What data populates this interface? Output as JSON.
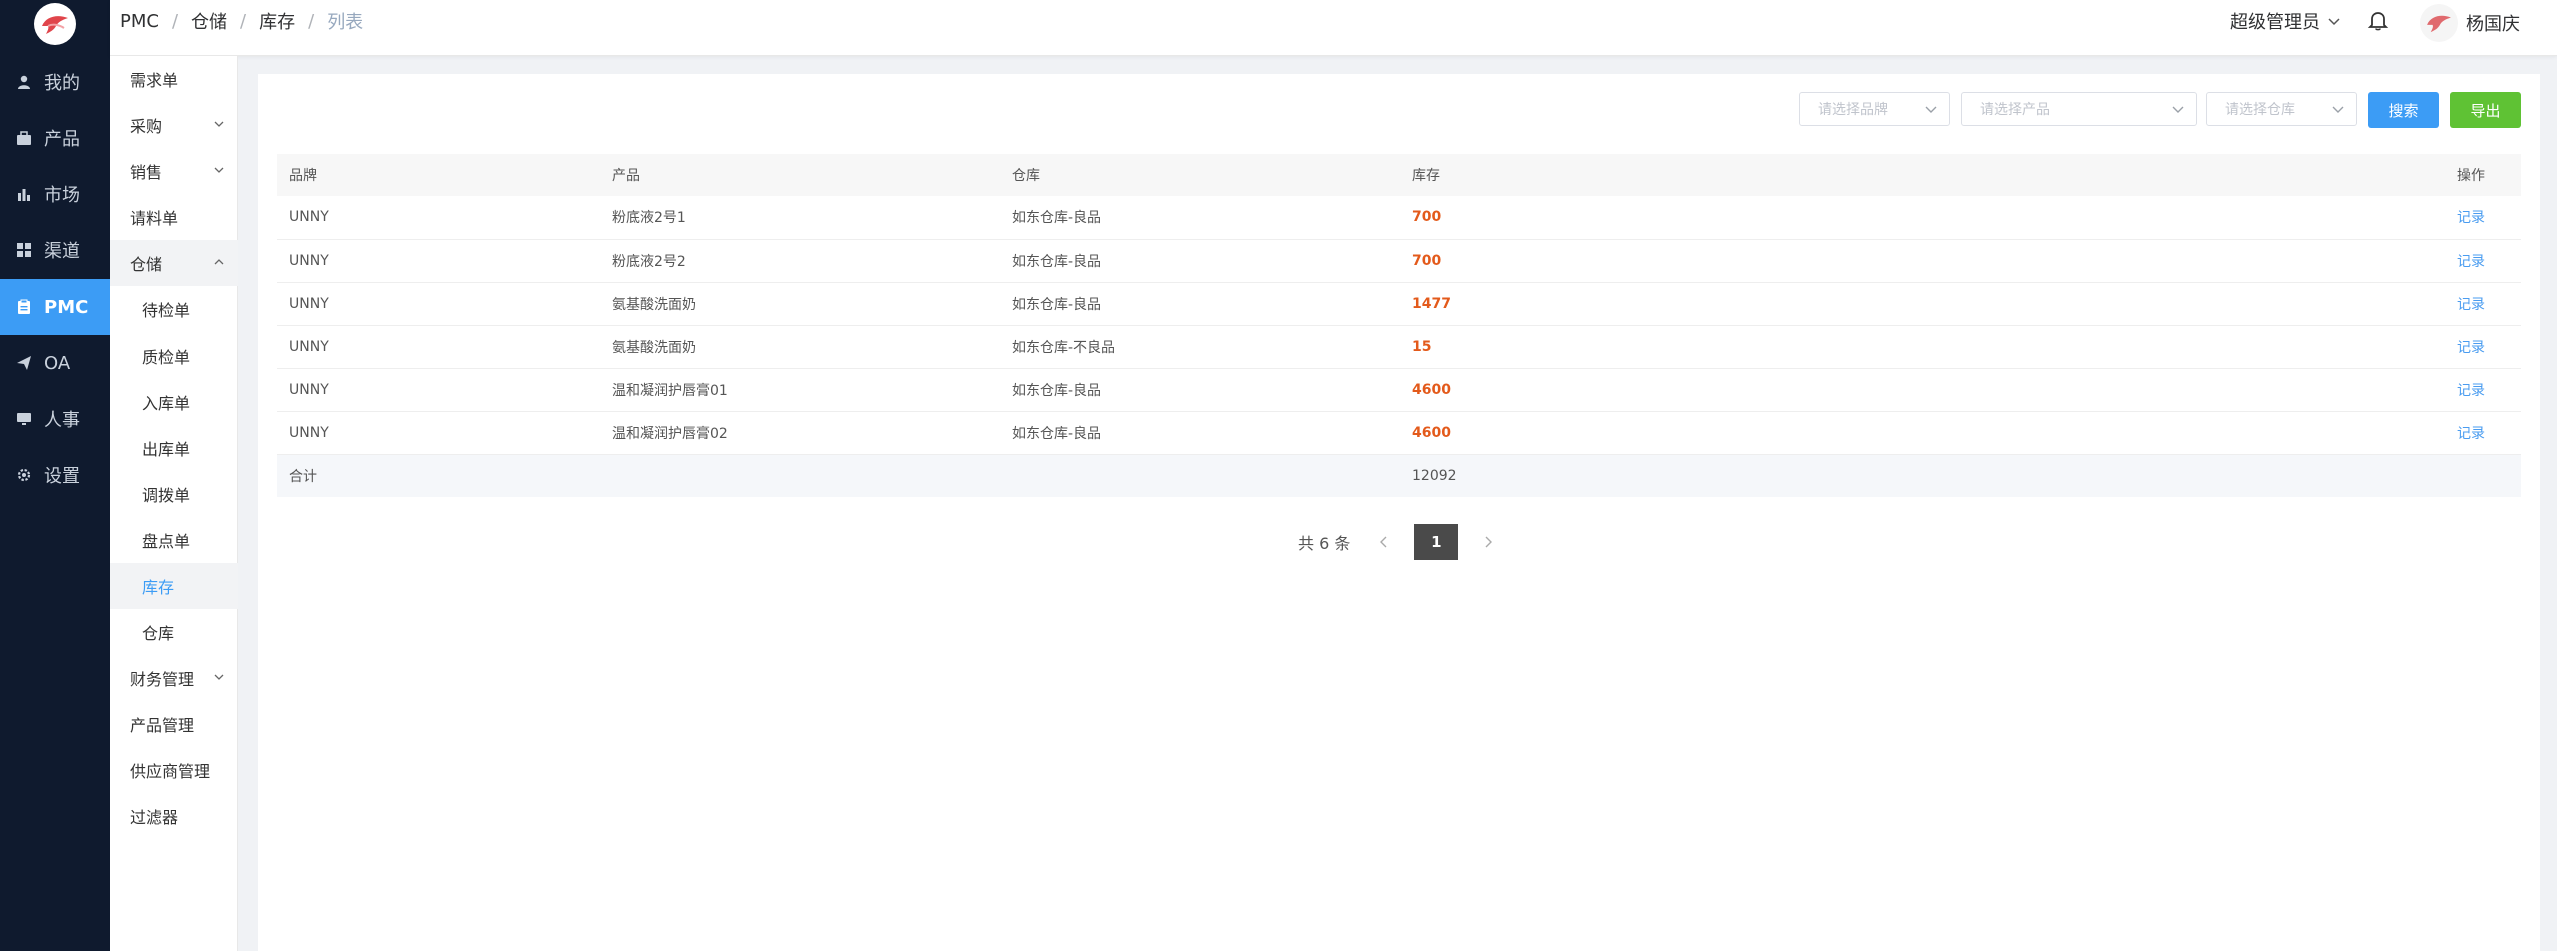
{
  "rail": {
    "items": [
      {
        "label": "我的",
        "icon": "user-icon"
      },
      {
        "label": "产品",
        "icon": "briefcase-icon"
      },
      {
        "label": "市场",
        "icon": "bar-chart-icon"
      },
      {
        "label": "渠道",
        "icon": "grid-icon"
      },
      {
        "label": "PMC",
        "icon": "clipboard-icon",
        "active": true
      },
      {
        "label": "OA",
        "icon": "paper-plane-icon"
      },
      {
        "label": "人事",
        "icon": "monitor-icon"
      },
      {
        "label": "设置",
        "icon": "gear-icon"
      }
    ]
  },
  "subnav": {
    "items": [
      {
        "label": "需求单"
      },
      {
        "label": "采购"
      },
      {
        "label": "销售"
      },
      {
        "label": "请料单"
      },
      {
        "label": "仓储"
      },
      {
        "label": "待检单"
      },
      {
        "label": "质检单"
      },
      {
        "label": "入库单"
      },
      {
        "label": "出库单"
      },
      {
        "label": "调拨单"
      },
      {
        "label": "盘点单"
      },
      {
        "label": "库存"
      },
      {
        "label": "仓库"
      },
      {
        "label": "财务管理"
      },
      {
        "label": "产品管理"
      },
      {
        "label": "供应商管理"
      },
      {
        "label": "过滤器"
      }
    ]
  },
  "header": {
    "breadcrumb": [
      "PMC",
      "仓储",
      "库存",
      "列表"
    ],
    "role": "超级管理员",
    "username": "杨国庆"
  },
  "filters": {
    "brand_placeholder": "请选择品牌",
    "product_placeholder": "请选择产品",
    "warehouse_placeholder": "请选择仓库",
    "search_label": "搜索",
    "export_label": "导出"
  },
  "table": {
    "columns": [
      "品牌",
      "产品",
      "仓库",
      "库存",
      "操作"
    ],
    "rows": [
      {
        "brand": "UNNY",
        "product": "粉底液2号1",
        "warehouse": "如东仓库-良品",
        "qty": "700",
        "action": "记录"
      },
      {
        "brand": "UNNY",
        "product": "粉底液2号2",
        "warehouse": "如东仓库-良品",
        "qty": "700",
        "action": "记录"
      },
      {
        "brand": "UNNY",
        "product": "氨基酸洗面奶",
        "warehouse": "如东仓库-良品",
        "qty": "1477",
        "action": "记录"
      },
      {
        "brand": "UNNY",
        "product": "氨基酸洗面奶",
        "warehouse": "如东仓库-不良品",
        "qty": "15",
        "action": "记录"
      },
      {
        "brand": "UNNY",
        "product": "温和凝润护唇膏01",
        "warehouse": "如东仓库-良品",
        "qty": "4600",
        "action": "记录"
      },
      {
        "brand": "UNNY",
        "product": "温和凝润护唇膏02",
        "warehouse": "如东仓库-良品",
        "qty": "4600",
        "action": "记录"
      }
    ],
    "footer": {
      "label": "合计",
      "total": "12092"
    }
  },
  "pagination": {
    "total_text": "共 6 条",
    "current_page": "1"
  },
  "colors": {
    "rail_bg": "#0f1a2e",
    "accent": "#3c9cf5",
    "export": "#5fc234",
    "qty": "#e35a1b"
  }
}
